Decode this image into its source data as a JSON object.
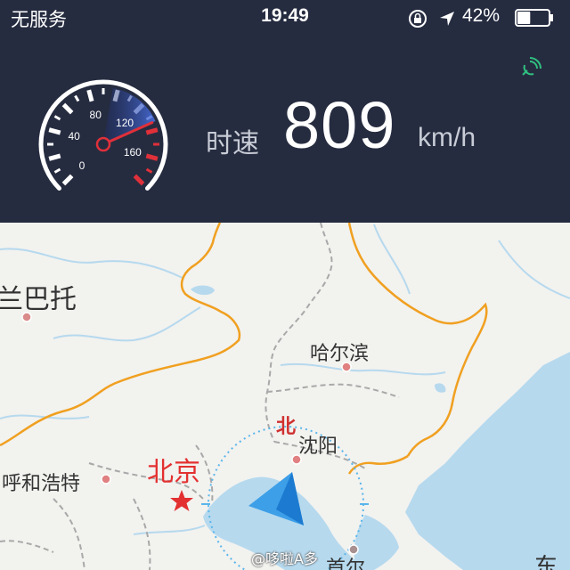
{
  "status_bar": {
    "carrier": "无服务",
    "time": "19:49",
    "battery_percent": "42%",
    "battery_level": 0.42
  },
  "speedometer": {
    "dial_labels": [
      "0",
      "40",
      "80",
      "120",
      "160"
    ],
    "current_speed_on_dial": 134,
    "label": "时速",
    "value": "809",
    "unit": "km/h"
  },
  "map": {
    "cities": {
      "ulaanbaatar": "兰巴托",
      "harbin": "哈尔滨",
      "shenyang": "沈阳",
      "hohhot": "呼和浩特",
      "beijing": "北京",
      "seoul": "首尔"
    },
    "compass_north": "北",
    "edge_partial_label": "东"
  },
  "watermark": "@哆啦A多",
  "colors": {
    "header_bg": "#262c40",
    "needle": "#e0303a",
    "gauge_arc": "#3a5fd0",
    "border_line": "#f0a020",
    "capital": "#e33030",
    "water": "#b6d9ee",
    "gps_signal": "#2fbf7f"
  },
  "icons": [
    "rotation-lock-icon",
    "location-arrow-icon",
    "battery-icon",
    "gps-signal-icon",
    "capital-star-icon",
    "position-arrow-icon"
  ]
}
